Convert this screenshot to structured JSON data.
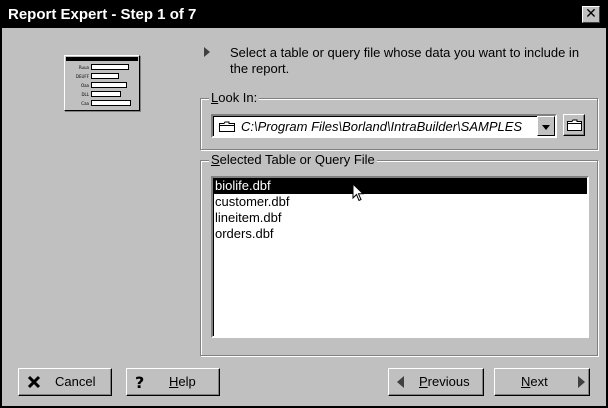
{
  "window": {
    "title": "Report Expert - Step 1 of 7",
    "close_glyph": "✕"
  },
  "thumbnail": {
    "icon": "report-form-preview-icon",
    "rows": [
      "Ruua",
      "DEUFF",
      "Oaa",
      "DLL",
      "Caa"
    ]
  },
  "instruction": {
    "icon": "arrow-right-icon",
    "text": "Select a table or query file whose data you want to include in the report."
  },
  "look_in": {
    "label_underlined": "L",
    "label_rest": "ook In:",
    "value": "C:\\Program Files\\Borland\\IntraBuilder\\SAMPLES",
    "icon": "folder-icon"
  },
  "file_group": {
    "label_underlined": "S",
    "label_rest": "elected Table or Query File",
    "items": [
      "biolife.dbf",
      "customer.dbf",
      "lineitem.dbf",
      "orders.dbf"
    ],
    "selected": "biolife.dbf"
  },
  "buttons": {
    "cancel": {
      "label": "Cancel",
      "icon": "x-icon"
    },
    "help": {
      "label_underlined": "H",
      "label_rest": "elp",
      "icon": "question-mark-icon"
    },
    "previous": {
      "label_underlined": "P",
      "label_rest": "revious",
      "icon": "left-triangle-icon"
    },
    "next": {
      "label_underlined": "N",
      "label_rest": "ext",
      "icon": "right-triangle-icon"
    }
  },
  "colors": {
    "title_bar": "#000000",
    "dialog_face": "#c0c0c0",
    "selection": "#000000"
  }
}
